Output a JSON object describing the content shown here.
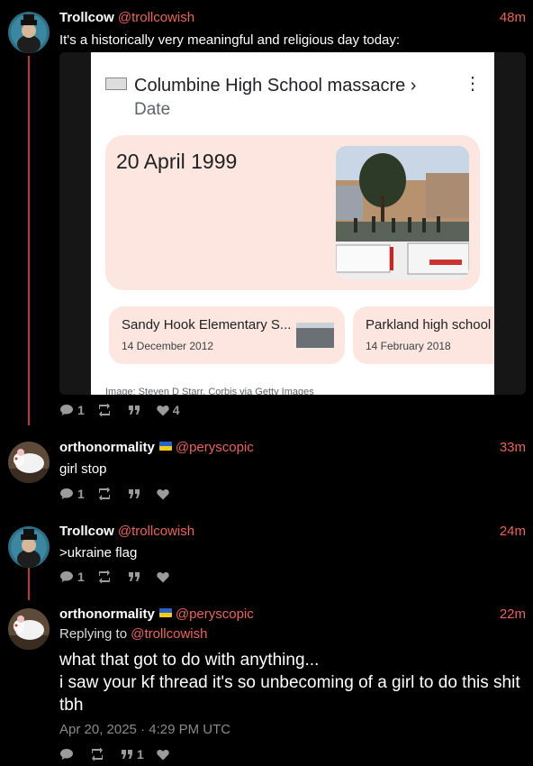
{
  "posts": [
    {
      "name": "Trollcow",
      "handle": "@trollcowish",
      "time": "48m",
      "text": "It's a historically very meaningful and religious day today:",
      "counts": {
        "replies": "1",
        "reposts": "",
        "quotes": "",
        "likes": "4"
      }
    },
    {
      "name": "orthonormality",
      "handle": "@peryscopic",
      "time": "33m",
      "text": "girl stop",
      "counts": {
        "replies": "1",
        "reposts": "",
        "quotes": "",
        "likes": ""
      }
    },
    {
      "name": "Trollcow",
      "handle": "@trollcowish",
      "time": "24m",
      "text": ">ukraine flag",
      "counts": {
        "replies": "1",
        "reposts": "",
        "quotes": "",
        "likes": ""
      }
    },
    {
      "name": "orthonormality",
      "handle": "@peryscopic",
      "time": "22m",
      "replying_label": "Replying to",
      "replying_handle": "@trollcowish",
      "text_lines": [
        "what that got to do with anything...",
        "i saw your kf thread it's so unbecoming of a girl to do this shit tbh"
      ],
      "timestamp": "Apr 20, 2025 · 4:29 PM UTC",
      "counts": {
        "replies": "",
        "reposts": "",
        "quotes": "1",
        "likes": ""
      }
    }
  ],
  "embed": {
    "title": "Columbine High School massacre ›",
    "subtitle": "Date",
    "date": "20 April 1999",
    "related": [
      {
        "title": "Sandy Hook Elementary S...",
        "date": "14 December 2012"
      },
      {
        "title": "Parkland high school s",
        "date": "14 February 2018"
      }
    ],
    "credit": "Image: Steven D Starr, Corbis via Getty Images"
  },
  "colors": {
    "accent": "#e8665e",
    "thread_line": "#b53b3b",
    "muted": "#9b9b9b",
    "card_bg": "#fde6df"
  },
  "icons": [
    "comment-icon",
    "repost-icon",
    "quote-icon",
    "heart-icon",
    "ukraine-flag-icon"
  ]
}
